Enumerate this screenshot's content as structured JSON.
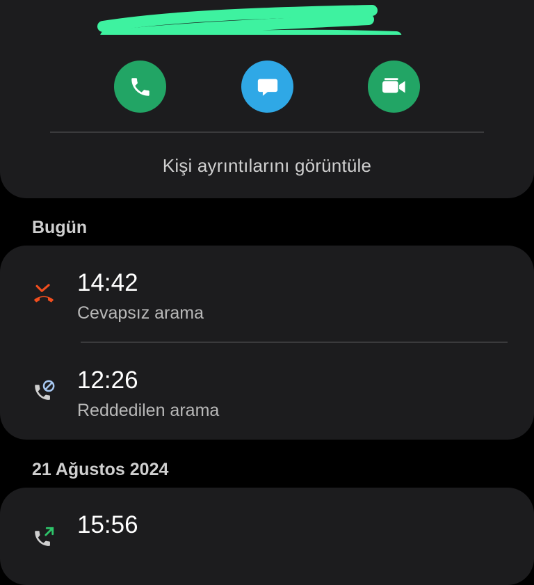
{
  "contact_actions": {
    "call": {
      "icon": "phone-icon",
      "color": "#22a565"
    },
    "message": {
      "icon": "chat-bubble-icon",
      "color": "#2fa8e6"
    },
    "video": {
      "icon": "video-camera-icon",
      "color": "#22a565"
    }
  },
  "view_details_label": "Kişi ayrıntılarını görüntüle",
  "redaction_color": "#3ef2a0",
  "sections": [
    {
      "label": "Bugün",
      "entries": [
        {
          "time": "14:42",
          "type": "Cevapsız arama",
          "icon": "missed-call-icon",
          "icon_color": "#f24e1e"
        },
        {
          "time": "12:26",
          "type": "Reddedilen arama",
          "icon": "rejected-call-icon",
          "icon_color": "#a7c7f0"
        }
      ]
    },
    {
      "label": "21 Ağustos 2024",
      "entries": [
        {
          "time": "15:56",
          "type": "",
          "icon": "outgoing-call-icon",
          "icon_color": "#2ec46a"
        }
      ]
    }
  ]
}
